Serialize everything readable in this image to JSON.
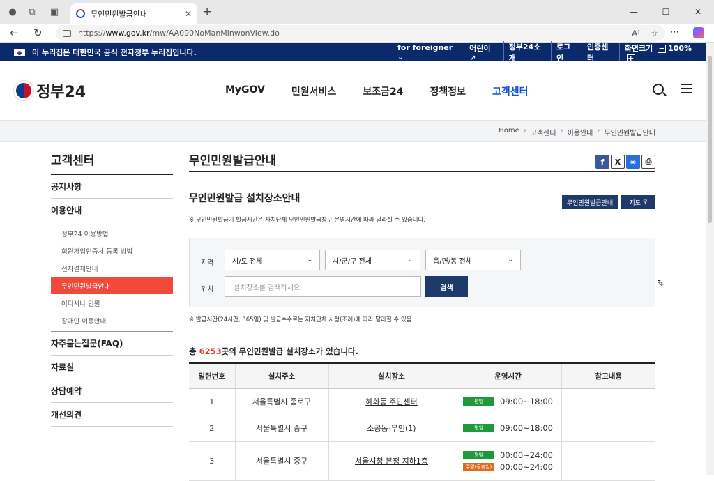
{
  "browser": {
    "tab_title": "무인민원발급안내",
    "url_domain": "www.gov.kr",
    "url_prefix": "https://",
    "url_path": "/mw/AA090NoManMinwonView.do"
  },
  "govbar": {
    "notice": "이 누리집은 대한민국 공식 전자정부 누리집입니다.",
    "links": [
      "for foreigner ⌄",
      "어린이 ↗",
      "정부24소개",
      "로그인",
      "인증센터"
    ],
    "zoom_label": "화면크기",
    "zoom_value": "100%"
  },
  "header": {
    "logo_text": "정부24",
    "nav": [
      "MyGOV",
      "민원서비스",
      "보조금24",
      "정책정보",
      "고객센터"
    ]
  },
  "breadcrumb": [
    "Home",
    "고객센터",
    "이용안내",
    "무인민원발급안내"
  ],
  "sidebar": {
    "title": "고객센터",
    "items": [
      "공지사항",
      "이용안내"
    ],
    "sub_items": [
      "정부24 이용방법",
      "회원가입인증서 등록 방법",
      "전자결제안내",
      "무인민원발급안내",
      "어디서나 민원",
      "장애인 이용안내"
    ],
    "items_after": [
      "자주묻는질문(FAQ)",
      "자료실",
      "상담예약",
      "개선의견"
    ]
  },
  "main": {
    "title": "무인민원발급안내",
    "section_title": "무인민원발급 설치장소안내",
    "btn_guide": "무인민원발급안내",
    "btn_map": "지도",
    "note": "※ 무인민원발급기 발급시간은 자치단체 무인민원발급창구 운영시간에 따라 달라질 수 있습니다.",
    "filter": {
      "region_label": "지역",
      "location_label": "위치",
      "sido": "시/도 전체",
      "sigungu": "시/군/구 전체",
      "eupmyeondong": "읍/면/동 전체",
      "search_placeholder": "설치장소를 검색하세요.",
      "search_button": "검색"
    },
    "note2": "※ 발급시간(24시간, 365일) 및 발급수수료는 자치단체 사정(조례)에 따라 달라질 수 있음",
    "count_prefix": "총 ",
    "count": "6253",
    "count_suffix": "곳의 무인민원발급 설치장소가 있습니다.",
    "table": {
      "headers": [
        "일련번호",
        "설치주소",
        "설치장소",
        "운영시간",
        "참고내용"
      ],
      "rows": [
        {
          "no": "1",
          "addr": "서울특별시 종로구",
          "place": "혜화동 주민센터",
          "hours": [
            {
              "tag": "평일",
              "color": "green",
              "time": "09:00~18:00"
            }
          ]
        },
        {
          "no": "2",
          "addr": "서울특별시 중구",
          "place": "소공동-무인(1)",
          "hours": [
            {
              "tag": "평일",
              "color": "green",
              "time": "09:00~18:00"
            }
          ]
        },
        {
          "no": "3",
          "addr": "서울특별시 중구",
          "place": "서울시청 본청 지하1층",
          "hours": [
            {
              "tag": "평일",
              "color": "green",
              "time": "00:00~24:00"
            },
            {
              "tag": "주말(공휴일)",
              "color": "orange",
              "time": "00:00~24:00"
            }
          ]
        }
      ]
    }
  }
}
